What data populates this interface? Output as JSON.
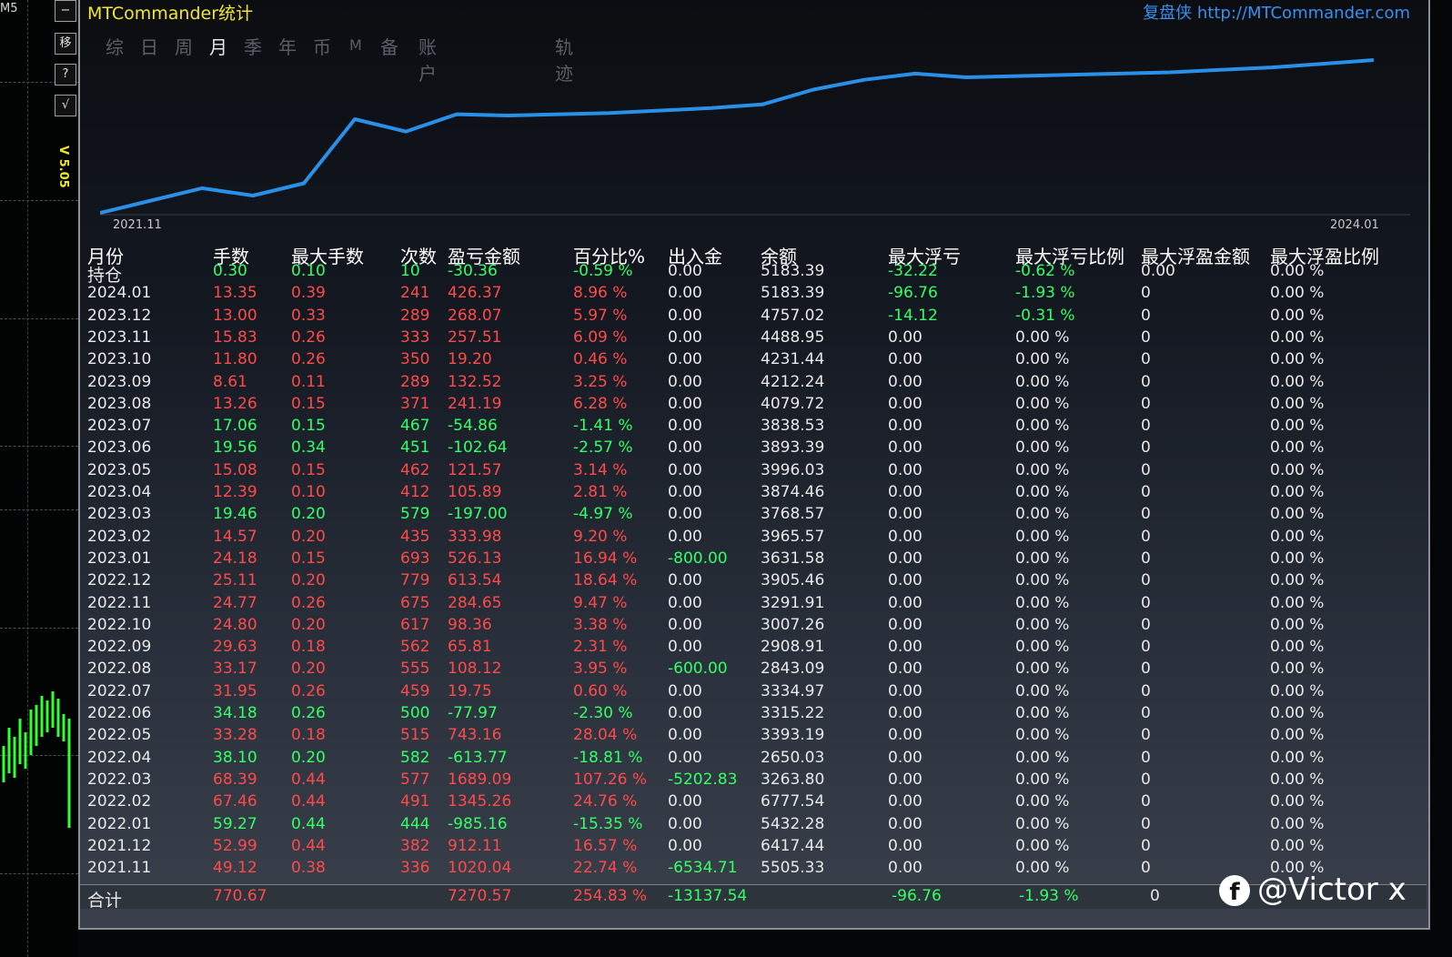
{
  "bg_label": "M5",
  "side_tools": [
    "−",
    "移",
    "?",
    "√"
  ],
  "version": "V 5.05",
  "title": "MTCommander统计",
  "brand_cn": "复盘侠",
  "brand_url": "http://MTCommander.com",
  "tabs": [
    "综",
    "日",
    "周",
    "月",
    "季",
    "年",
    "币",
    "M",
    "备",
    "账户",
    "轨迹"
  ],
  "active_tab": "月",
  "chart_data": {
    "type": "line",
    "x_start_label": "2021.11",
    "x_end_label": "2024.01",
    "series": [
      {
        "color": "#2a8fe6",
        "values": [
          0,
          10,
          20,
          14,
          24,
          76,
          66,
          80,
          79,
          80,
          81,
          83,
          85,
          88,
          100,
          108,
          113,
          110,
          111,
          112,
          113,
          114,
          116,
          118,
          121,
          124
        ]
      }
    ]
  },
  "headers": [
    "月份",
    "手数",
    "最大手数",
    "次数",
    "盈亏金额",
    "百分比%",
    "出入金",
    "余额",
    "最大浮亏",
    "最大浮亏比例",
    "最大浮盈金额",
    "最大浮盈比例"
  ],
  "rows": [
    {
      "month": "持仓",
      "lots": "0.30",
      "max_lots": "0.10",
      "count": "10",
      "pnl": "-30.36",
      "pct": "-0.59 %",
      "flow": "0.00",
      "balance": "5183.39",
      "max_float_loss": "-32.22",
      "max_float_loss_pct": "-0.62 %",
      "max_float_profit": "0.00",
      "max_float_profit_pct": "0.00 %"
    },
    {
      "month": "2024.01",
      "lots": "13.35",
      "max_lots": "0.39",
      "count": "241",
      "pnl": "426.37",
      "pct": "8.96 %",
      "flow": "0.00",
      "balance": "5183.39",
      "max_float_loss": "-96.76",
      "max_float_loss_pct": "-1.93 %",
      "max_float_profit": "0",
      "max_float_profit_pct": "0.00 %"
    },
    {
      "month": "2023.12",
      "lots": "13.00",
      "max_lots": "0.33",
      "count": "289",
      "pnl": "268.07",
      "pct": "5.97 %",
      "flow": "0.00",
      "balance": "4757.02",
      "max_float_loss": "-14.12",
      "max_float_loss_pct": "-0.31 %",
      "max_float_profit": "0",
      "max_float_profit_pct": "0.00 %"
    },
    {
      "month": "2023.11",
      "lots": "15.83",
      "max_lots": "0.26",
      "count": "333",
      "pnl": "257.51",
      "pct": "6.09 %",
      "flow": "0.00",
      "balance": "4488.95",
      "max_float_loss": "0.00",
      "max_float_loss_pct": "0.00 %",
      "max_float_profit": "0",
      "max_float_profit_pct": "0.00 %"
    },
    {
      "month": "2023.10",
      "lots": "11.80",
      "max_lots": "0.26",
      "count": "350",
      "pnl": "19.20",
      "pct": "0.46 %",
      "flow": "0.00",
      "balance": "4231.44",
      "max_float_loss": "0.00",
      "max_float_loss_pct": "0.00 %",
      "max_float_profit": "0",
      "max_float_profit_pct": "0.00 %"
    },
    {
      "month": "2023.09",
      "lots": "8.61",
      "max_lots": "0.11",
      "count": "289",
      "pnl": "132.52",
      "pct": "3.25 %",
      "flow": "0.00",
      "balance": "4212.24",
      "max_float_loss": "0.00",
      "max_float_loss_pct": "0.00 %",
      "max_float_profit": "0",
      "max_float_profit_pct": "0.00 %"
    },
    {
      "month": "2023.08",
      "lots": "13.26",
      "max_lots": "0.15",
      "count": "371",
      "pnl": "241.19",
      "pct": "6.28 %",
      "flow": "0.00",
      "balance": "4079.72",
      "max_float_loss": "0.00",
      "max_float_loss_pct": "0.00 %",
      "max_float_profit": "0",
      "max_float_profit_pct": "0.00 %"
    },
    {
      "month": "2023.07",
      "lots": "17.06",
      "max_lots": "0.15",
      "count": "467",
      "pnl": "-54.86",
      "pct": "-1.41 %",
      "flow": "0.00",
      "balance": "3838.53",
      "max_float_loss": "0.00",
      "max_float_loss_pct": "0.00 %",
      "max_float_profit": "0",
      "max_float_profit_pct": "0.00 %"
    },
    {
      "month": "2023.06",
      "lots": "19.56",
      "max_lots": "0.34",
      "count": "451",
      "pnl": "-102.64",
      "pct": "-2.57 %",
      "flow": "0.00",
      "balance": "3893.39",
      "max_float_loss": "0.00",
      "max_float_loss_pct": "0.00 %",
      "max_float_profit": "0",
      "max_float_profit_pct": "0.00 %"
    },
    {
      "month": "2023.05",
      "lots": "15.08",
      "max_lots": "0.15",
      "count": "462",
      "pnl": "121.57",
      "pct": "3.14 %",
      "flow": "0.00",
      "balance": "3996.03",
      "max_float_loss": "0.00",
      "max_float_loss_pct": "0.00 %",
      "max_float_profit": "0",
      "max_float_profit_pct": "0.00 %"
    },
    {
      "month": "2023.04",
      "lots": "12.39",
      "max_lots": "0.10",
      "count": "412",
      "pnl": "105.89",
      "pct": "2.81 %",
      "flow": "0.00",
      "balance": "3874.46",
      "max_float_loss": "0.00",
      "max_float_loss_pct": "0.00 %",
      "max_float_profit": "0",
      "max_float_profit_pct": "0.00 %"
    },
    {
      "month": "2023.03",
      "lots": "19.46",
      "max_lots": "0.20",
      "count": "579",
      "pnl": "-197.00",
      "pct": "-4.97 %",
      "flow": "0.00",
      "balance": "3768.57",
      "max_float_loss": "0.00",
      "max_float_loss_pct": "0.00 %",
      "max_float_profit": "0",
      "max_float_profit_pct": "0.00 %"
    },
    {
      "month": "2023.02",
      "lots": "14.57",
      "max_lots": "0.20",
      "count": "435",
      "pnl": "333.98",
      "pct": "9.20 %",
      "flow": "0.00",
      "balance": "3965.57",
      "max_float_loss": "0.00",
      "max_float_loss_pct": "0.00 %",
      "max_float_profit": "0",
      "max_float_profit_pct": "0.00 %"
    },
    {
      "month": "2023.01",
      "lots": "24.18",
      "max_lots": "0.15",
      "count": "693",
      "pnl": "526.13",
      "pct": "16.94 %",
      "flow": "-800.00",
      "balance": "3631.58",
      "max_float_loss": "0.00",
      "max_float_loss_pct": "0.00 %",
      "max_float_profit": "0",
      "max_float_profit_pct": "0.00 %"
    },
    {
      "month": "2022.12",
      "lots": "25.11",
      "max_lots": "0.20",
      "count": "779",
      "pnl": "613.54",
      "pct": "18.64 %",
      "flow": "0.00",
      "balance": "3905.46",
      "max_float_loss": "0.00",
      "max_float_loss_pct": "0.00 %",
      "max_float_profit": "0",
      "max_float_profit_pct": "0.00 %"
    },
    {
      "month": "2022.11",
      "lots": "24.77",
      "max_lots": "0.26",
      "count": "675",
      "pnl": "284.65",
      "pct": "9.47 %",
      "flow": "0.00",
      "balance": "3291.91",
      "max_float_loss": "0.00",
      "max_float_loss_pct": "0.00 %",
      "max_float_profit": "0",
      "max_float_profit_pct": "0.00 %"
    },
    {
      "month": "2022.10",
      "lots": "24.80",
      "max_lots": "0.20",
      "count": "617",
      "pnl": "98.36",
      "pct": "3.38 %",
      "flow": "0.00",
      "balance": "3007.26",
      "max_float_loss": "0.00",
      "max_float_loss_pct": "0.00 %",
      "max_float_profit": "0",
      "max_float_profit_pct": "0.00 %"
    },
    {
      "month": "2022.09",
      "lots": "29.63",
      "max_lots": "0.18",
      "count": "562",
      "pnl": "65.81",
      "pct": "2.31 %",
      "flow": "0.00",
      "balance": "2908.91",
      "max_float_loss": "0.00",
      "max_float_loss_pct": "0.00 %",
      "max_float_profit": "0",
      "max_float_profit_pct": "0.00 %"
    },
    {
      "month": "2022.08",
      "lots": "33.17",
      "max_lots": "0.20",
      "count": "555",
      "pnl": "108.12",
      "pct": "3.95 %",
      "flow": "-600.00",
      "balance": "2843.09",
      "max_float_loss": "0.00",
      "max_float_loss_pct": "0.00 %",
      "max_float_profit": "0",
      "max_float_profit_pct": "0.00 %"
    },
    {
      "month": "2022.07",
      "lots": "31.95",
      "max_lots": "0.26",
      "count": "459",
      "pnl": "19.75",
      "pct": "0.60 %",
      "flow": "0.00",
      "balance": "3334.97",
      "max_float_loss": "0.00",
      "max_float_loss_pct": "0.00 %",
      "max_float_profit": "0",
      "max_float_profit_pct": "0.00 %"
    },
    {
      "month": "2022.06",
      "lots": "34.18",
      "max_lots": "0.26",
      "count": "500",
      "pnl": "-77.97",
      "pct": "-2.30 %",
      "flow": "0.00",
      "balance": "3315.22",
      "max_float_loss": "0.00",
      "max_float_loss_pct": "0.00 %",
      "max_float_profit": "0",
      "max_float_profit_pct": "0.00 %"
    },
    {
      "month": "2022.05",
      "lots": "33.28",
      "max_lots": "0.18",
      "count": "515",
      "pnl": "743.16",
      "pct": "28.04 %",
      "flow": "0.00",
      "balance": "3393.19",
      "max_float_loss": "0.00",
      "max_float_loss_pct": "0.00 %",
      "max_float_profit": "0",
      "max_float_profit_pct": "0.00 %"
    },
    {
      "month": "2022.04",
      "lots": "38.10",
      "max_lots": "0.20",
      "count": "582",
      "pnl": "-613.77",
      "pct": "-18.81 %",
      "flow": "0.00",
      "balance": "2650.03",
      "max_float_loss": "0.00",
      "max_float_loss_pct": "0.00 %",
      "max_float_profit": "0",
      "max_float_profit_pct": "0.00 %"
    },
    {
      "month": "2022.03",
      "lots": "68.39",
      "max_lots": "0.44",
      "count": "577",
      "pnl": "1689.09",
      "pct": "107.26 %",
      "flow": "-5202.83",
      "balance": "3263.80",
      "max_float_loss": "0.00",
      "max_float_loss_pct": "0.00 %",
      "max_float_profit": "0",
      "max_float_profit_pct": "0.00 %"
    },
    {
      "month": "2022.02",
      "lots": "67.46",
      "max_lots": "0.44",
      "count": "491",
      "pnl": "1345.26",
      "pct": "24.76 %",
      "flow": "0.00",
      "balance": "6777.54",
      "max_float_loss": "0.00",
      "max_float_loss_pct": "0.00 %",
      "max_float_profit": "0",
      "max_float_profit_pct": "0.00 %"
    },
    {
      "month": "2022.01",
      "lots": "59.27",
      "max_lots": "0.44",
      "count": "444",
      "pnl": "-985.16",
      "pct": "-15.35 %",
      "flow": "0.00",
      "balance": "5432.28",
      "max_float_loss": "0.00",
      "max_float_loss_pct": "0.00 %",
      "max_float_profit": "0",
      "max_float_profit_pct": "0.00 %"
    },
    {
      "month": "2021.12",
      "lots": "52.99",
      "max_lots": "0.44",
      "count": "382",
      "pnl": "912.11",
      "pct": "16.57 %",
      "flow": "0.00",
      "balance": "6417.44",
      "max_float_loss": "0.00",
      "max_float_loss_pct": "0.00 %",
      "max_float_profit": "0",
      "max_float_profit_pct": "0.00 %"
    },
    {
      "month": "2021.11",
      "lots": "49.12",
      "max_lots": "0.38",
      "count": "336",
      "pnl": "1020.04",
      "pct": "22.74 %",
      "flow": "-6534.71",
      "balance": "5505.33",
      "max_float_loss": "0.00",
      "max_float_loss_pct": "0.00 %",
      "max_float_profit": "0",
      "max_float_profit_pct": "0.00 %"
    }
  ],
  "total": {
    "label": "合计",
    "lots": "770.67",
    "pnl": "7270.57",
    "pct": "254.83 %",
    "flow": "-13137.54",
    "max_float_loss": "-96.76",
    "max_float_loss_pct": "-1.93 %",
    "max_float_profit": "0"
  },
  "watermark": "@Victor x",
  "colors": {
    "title": "#f5e62a",
    "brand": "#3a8ff0",
    "line": "#2a8fe6",
    "profit": "#ff4a4a",
    "loss": "#33ff66"
  }
}
